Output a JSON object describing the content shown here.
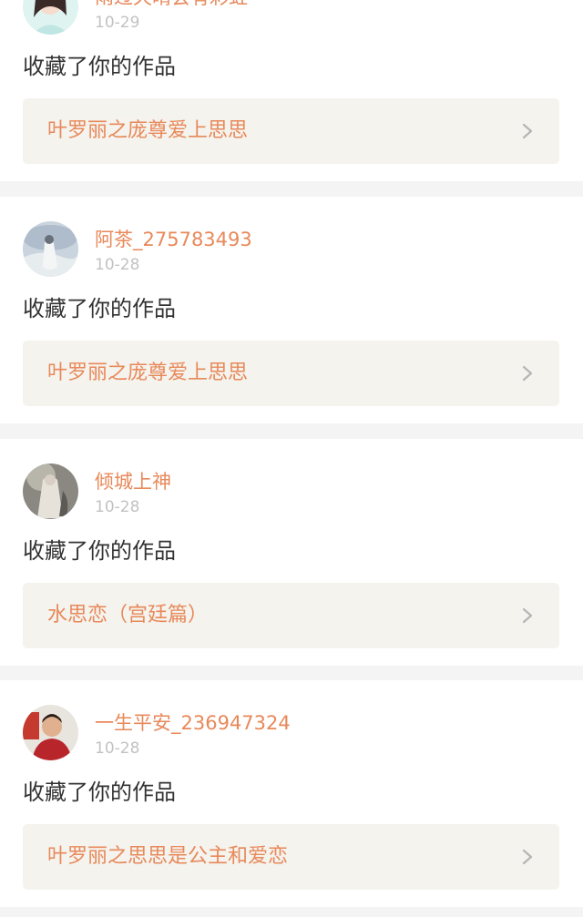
{
  "notifications": [
    {
      "username": "雨过天晴会有彩虹",
      "date": "10-29",
      "action": "收藏了你的作品",
      "work_title": "叶罗丽之庞尊爱上思思",
      "avatar": "avatar-girl-icon"
    },
    {
      "username": "阿茶_275783493",
      "date": "10-28",
      "action": "收藏了你的作品",
      "work_title": "叶罗丽之庞尊爱上思思",
      "avatar": "avatar-ink-painting-icon"
    },
    {
      "username": "倾城上神",
      "date": "10-28",
      "action": "收藏了你的作品",
      "work_title": "水思恋（宫廷篇）",
      "avatar": "avatar-fantasy-icon"
    },
    {
      "username": "一生平安_236947324",
      "date": "10-28",
      "action": "收藏了你的作品",
      "work_title": "叶罗丽之思思是公主和爱恋",
      "avatar": "avatar-photo-icon"
    }
  ],
  "colors": {
    "accent": "#e8895a",
    "date": "#c2c2c2",
    "text": "#333333",
    "link_bg": "#f4f3ee",
    "separator": "#f4f4f4"
  }
}
